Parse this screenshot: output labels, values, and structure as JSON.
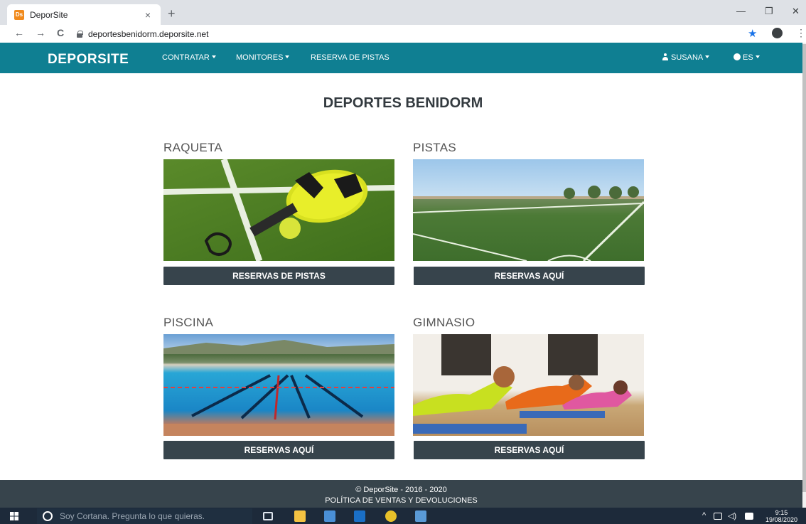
{
  "browser": {
    "tab_title": "DeporSite",
    "favicon_text": "Ds",
    "tab_close": "×",
    "new_tab": "+",
    "url": "deportesbenidorm.deporsite.net",
    "minimize": "—",
    "restore": "❐",
    "close": "✕",
    "back": "←",
    "forward": "→",
    "reload": "C",
    "star": "★",
    "menu": "⋮"
  },
  "navbar": {
    "brand": "DEPORSITE",
    "items": [
      {
        "label": "CONTRATAR"
      },
      {
        "label": "MONITORES"
      },
      {
        "label": "RESERVA DE PISTAS"
      }
    ],
    "user": "SUSANA",
    "language": "ES"
  },
  "main": {
    "title": "DEPORTES BENIDORM",
    "cards": [
      {
        "title": "RAQUETA",
        "button": "RESERVAS DE PISTAS",
        "image": "padel-racket-photo"
      },
      {
        "title": "PISTAS",
        "button": "RESERVAS AQUÍ",
        "image": "football-field-photo"
      },
      {
        "title": "PISCINA",
        "button": "RESERVAS AQUÍ",
        "image": "swimming-pool-photo"
      },
      {
        "title": "GIMNASIO",
        "button": "RESERVAS AQUÍ",
        "image": "gym-class-photo"
      }
    ]
  },
  "footer": {
    "copyright": "© DeporSite - 2016 - 2020",
    "policy": "POLÍTICA DE VENTAS Y DEVOLUCIONES"
  },
  "taskbar": {
    "search_placeholder": "Soy Cortana. Pregunta lo que quieras.",
    "time": "9:15",
    "date": "19/08/2020"
  },
  "colors": {
    "navbar": "#0f7f92",
    "button": "#37444c",
    "footer": "#37444c"
  }
}
